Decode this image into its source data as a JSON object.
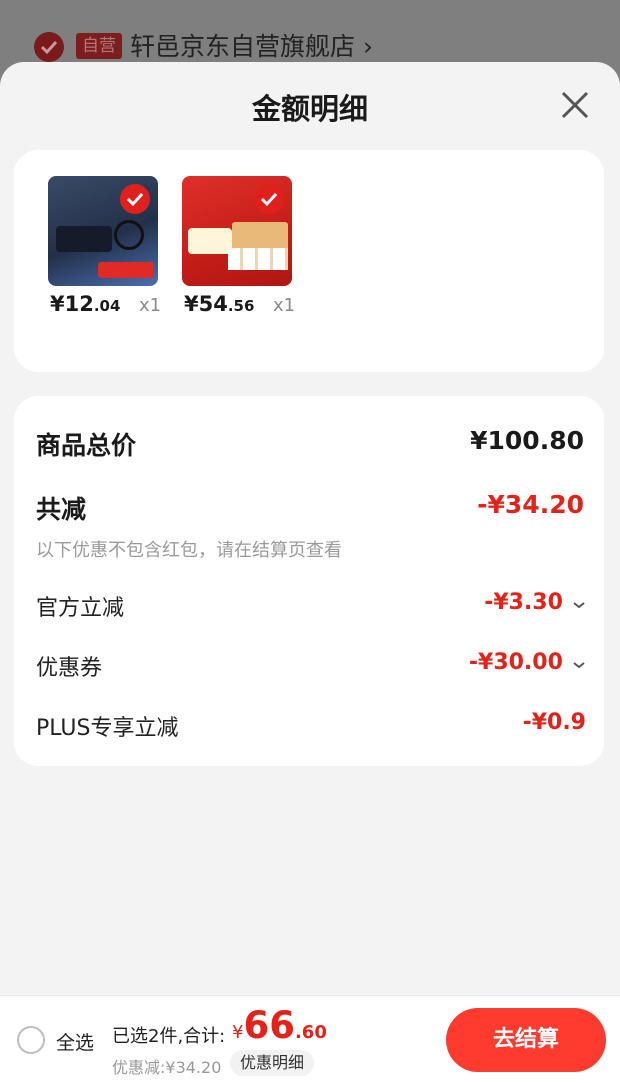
{
  "store": {
    "badge": "自营",
    "name": "轩邑京东自营旗舰店",
    "arrow": "›"
  },
  "sheet": {
    "title": "金额明细"
  },
  "products": [
    {
      "price_int": "¥12",
      "price_dec": ".04",
      "qty": "x1"
    },
    {
      "price_int": "¥54",
      "price_dec": ".56",
      "qty": "x1"
    }
  ],
  "summary": {
    "total_label": "商品总价",
    "total_value": "¥100.80",
    "reduce_label": "共减",
    "reduce_value": "-¥34.20",
    "note": "以下优惠不包含红包，请在结算页查看",
    "items": [
      {
        "label": "官方立减",
        "value": "-¥3.30"
      },
      {
        "label": "优惠券",
        "value": "-¥30.00"
      },
      {
        "label": "PLUS专享立减",
        "value": "-¥0.9"
      }
    ]
  },
  "bottom": {
    "select_all": "全选",
    "selected_count": "已选2件,合计:",
    "total_yen": "¥",
    "total_int": "66",
    "total_dec": ".60",
    "discount": "优惠减:¥34.20",
    "detail_button": "优惠明细",
    "checkout_button": "去结算"
  },
  "colors": {
    "accent": "#e2231a",
    "checkout": "#ff3b30"
  }
}
